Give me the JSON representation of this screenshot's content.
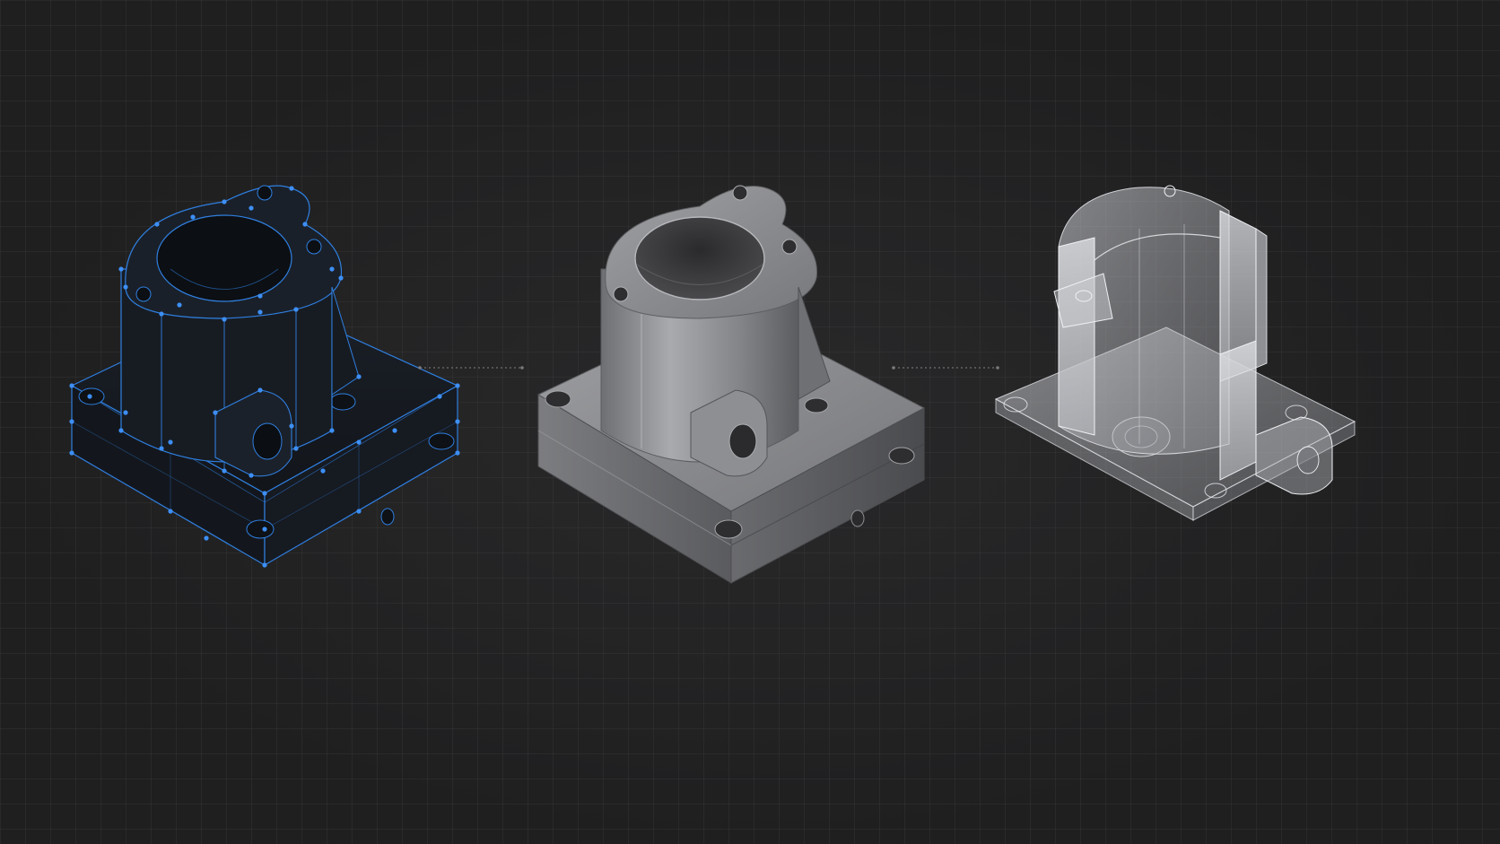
{
  "views": [
    {
      "name": "wireframe",
      "edge_color": "#2f7fe0",
      "vertex_color": "#3d8ff5",
      "fill_color": "#161b22"
    },
    {
      "name": "solid",
      "fill_color": "#8c8d90",
      "highlight_color": "#b5b6b8",
      "shadow_color": "#4c4d50"
    },
    {
      "name": "section",
      "fill_color": "#c9cbd0",
      "edge_color": "#e6e8ec"
    }
  ],
  "connector_color": "#6f6f72",
  "grid_color": "#2b2b2d",
  "background_color": "#1f1f20"
}
